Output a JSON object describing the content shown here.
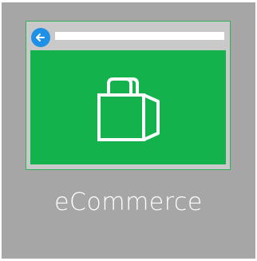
{
  "tile": {
    "label": "eCommerce",
    "background_color": "#a6a6a6"
  },
  "illustration": {
    "window": {
      "content_color": "#13b24c",
      "frame_color": "#c9c9c9",
      "addressbar_color": "#ffffff"
    },
    "icons": {
      "back": "arrow-left-icon",
      "main": "shopping-bag-icon"
    },
    "back_button_color": "#1e90e6"
  }
}
